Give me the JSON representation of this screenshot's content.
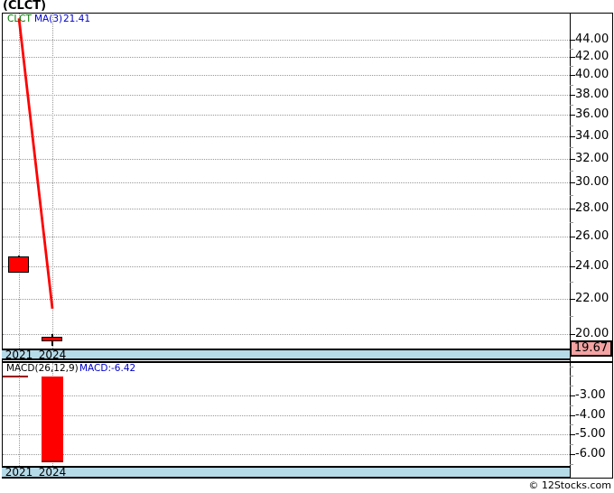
{
  "title": "(CLCT)",
  "price_panel": {
    "symbol_label": "CLCT",
    "ma_label": "MA(3)",
    "ma_value": "21.41",
    "last_price": "19.67"
  },
  "macd_panel": {
    "params_label": "MACD(26,12,9)",
    "value_label": "MACD:-6.42"
  },
  "footer": {
    "credit": "© 12Stocks.com"
  },
  "colors": {
    "candle": "#ff0000",
    "ma_line": "#ff0000",
    "histogram": "#ff0000",
    "macd_line": "#990000",
    "band": "#b5dae8",
    "last_price_bg": "#f4a2a2",
    "symbol_green": "#007700",
    "value_blue": "#0000cc",
    "grid": "#999999",
    "axis_text": "#000000"
  },
  "chart_data": [
    {
      "type": "candlestick",
      "panel": "price",
      "symbol": "CLCT",
      "scale": "log",
      "grid": "dotted",
      "y_axis": {
        "side": "right",
        "tick_values": [
          44,
          42,
          40,
          38,
          36,
          34,
          32,
          30,
          28,
          26,
          24,
          22,
          20
        ],
        "tick_labels": [
          "44.00",
          "42.00",
          "40.00",
          "38.00",
          "36.00",
          "34.00",
          "32.00",
          "30.00",
          "28.00",
          "26.00",
          "24.00",
          "22.00",
          "20.00"
        ],
        "minor_tick_values": [
          43,
          41,
          39,
          37,
          35,
          33,
          31,
          29,
          27,
          25,
          23,
          21
        ],
        "visible_range": [
          19.25,
          47.3
        ]
      },
      "x_axis": {
        "tick_years": [
          2021,
          2024
        ],
        "tick_labels": [
          "2021",
          "2024"
        ]
      },
      "candles": [
        {
          "year": 2021,
          "open": 24.6,
          "high": 24.7,
          "low": 23.6,
          "close": 23.6,
          "direction": "down"
        },
        {
          "year": 2024,
          "open": 19.84,
          "high": 20.0,
          "low": 19.36,
          "close": 19.6,
          "direction": "down"
        }
      ],
      "ma3": {
        "label": "MA(3)",
        "current": 21.41,
        "points": [
          {
            "year": 2021,
            "value": 46.6
          },
          {
            "year": 2024,
            "value": 21.41
          }
        ]
      },
      "last_price": 19.67
    },
    {
      "type": "bar",
      "panel": "macd",
      "label": "MACD(26,12,9)",
      "current_label": "MACD:-6.42",
      "current_value": -6.42,
      "y_axis": {
        "side": "right",
        "tick_values": [
          -3,
          -4,
          -5,
          -6
        ],
        "tick_labels": [
          "-3.00",
          "-4.00",
          "-5.00",
          "-6.00"
        ],
        "minor_tick_values": [
          -1.5,
          -2,
          -2.5,
          -3.5,
          -4.5,
          -5.5,
          -6.5
        ],
        "visible_range": [
          -6.6,
          -1.25
        ]
      },
      "x_axis": {
        "tick_years": [
          2021,
          2024
        ],
        "tick_labels": [
          "2021",
          "2024"
        ]
      },
      "histogram_bars": [
        {
          "year": 2024,
          "from": -2.05,
          "to": -6.42
        }
      ],
      "macd_line_segment": {
        "value": -2.05,
        "year_from": 2019.5,
        "year_to": 2021.8
      }
    }
  ]
}
